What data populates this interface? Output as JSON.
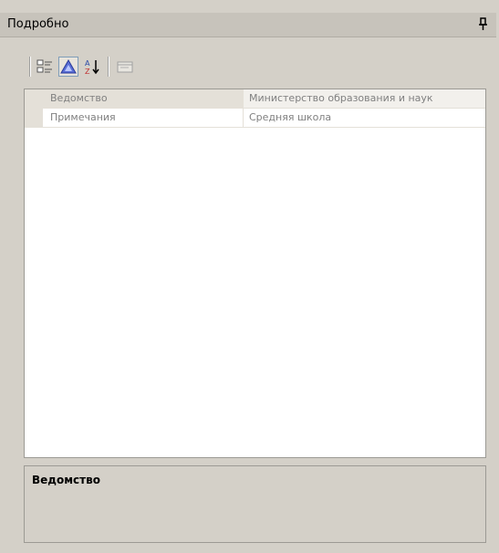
{
  "panel": {
    "title": "Подробно",
    "pin_icon": "pin-icon"
  },
  "toolbar": {
    "buttons": [
      {
        "icon": "categorized-icon",
        "active": false
      },
      {
        "icon": "alphabetical-warning-icon",
        "active": true
      },
      {
        "icon": "sort-az-icon",
        "active": false
      },
      {
        "icon": "property-pages-icon",
        "active": false
      }
    ]
  },
  "grid": {
    "rows": [
      {
        "name": "Ведомство",
        "value": "Министерство образования и наук"
      },
      {
        "name": "Примечания",
        "value": "Средняя школа"
      }
    ]
  },
  "description": {
    "title": "Ведомство"
  }
}
